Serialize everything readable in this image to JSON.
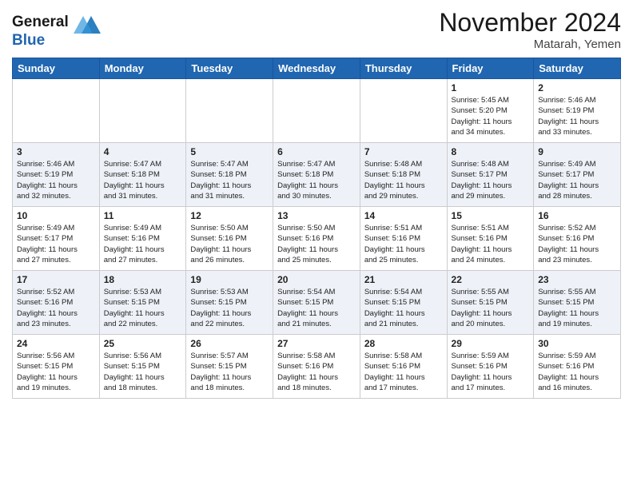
{
  "header": {
    "logo_line1": "General",
    "logo_line2": "Blue",
    "month_title": "November 2024",
    "location": "Matarah, Yemen"
  },
  "weekdays": [
    "Sunday",
    "Monday",
    "Tuesday",
    "Wednesday",
    "Thursday",
    "Friday",
    "Saturday"
  ],
  "weeks": [
    [
      {
        "day": "",
        "info": ""
      },
      {
        "day": "",
        "info": ""
      },
      {
        "day": "",
        "info": ""
      },
      {
        "day": "",
        "info": ""
      },
      {
        "day": "",
        "info": ""
      },
      {
        "day": "1",
        "info": "Sunrise: 5:45 AM\nSunset: 5:20 PM\nDaylight: 11 hours\nand 34 minutes."
      },
      {
        "day": "2",
        "info": "Sunrise: 5:46 AM\nSunset: 5:19 PM\nDaylight: 11 hours\nand 33 minutes."
      }
    ],
    [
      {
        "day": "3",
        "info": "Sunrise: 5:46 AM\nSunset: 5:19 PM\nDaylight: 11 hours\nand 32 minutes."
      },
      {
        "day": "4",
        "info": "Sunrise: 5:47 AM\nSunset: 5:18 PM\nDaylight: 11 hours\nand 31 minutes."
      },
      {
        "day": "5",
        "info": "Sunrise: 5:47 AM\nSunset: 5:18 PM\nDaylight: 11 hours\nand 31 minutes."
      },
      {
        "day": "6",
        "info": "Sunrise: 5:47 AM\nSunset: 5:18 PM\nDaylight: 11 hours\nand 30 minutes."
      },
      {
        "day": "7",
        "info": "Sunrise: 5:48 AM\nSunset: 5:18 PM\nDaylight: 11 hours\nand 29 minutes."
      },
      {
        "day": "8",
        "info": "Sunrise: 5:48 AM\nSunset: 5:17 PM\nDaylight: 11 hours\nand 29 minutes."
      },
      {
        "day": "9",
        "info": "Sunrise: 5:49 AM\nSunset: 5:17 PM\nDaylight: 11 hours\nand 28 minutes."
      }
    ],
    [
      {
        "day": "10",
        "info": "Sunrise: 5:49 AM\nSunset: 5:17 PM\nDaylight: 11 hours\nand 27 minutes."
      },
      {
        "day": "11",
        "info": "Sunrise: 5:49 AM\nSunset: 5:16 PM\nDaylight: 11 hours\nand 27 minutes."
      },
      {
        "day": "12",
        "info": "Sunrise: 5:50 AM\nSunset: 5:16 PM\nDaylight: 11 hours\nand 26 minutes."
      },
      {
        "day": "13",
        "info": "Sunrise: 5:50 AM\nSunset: 5:16 PM\nDaylight: 11 hours\nand 25 minutes."
      },
      {
        "day": "14",
        "info": "Sunrise: 5:51 AM\nSunset: 5:16 PM\nDaylight: 11 hours\nand 25 minutes."
      },
      {
        "day": "15",
        "info": "Sunrise: 5:51 AM\nSunset: 5:16 PM\nDaylight: 11 hours\nand 24 minutes."
      },
      {
        "day": "16",
        "info": "Sunrise: 5:52 AM\nSunset: 5:16 PM\nDaylight: 11 hours\nand 23 minutes."
      }
    ],
    [
      {
        "day": "17",
        "info": "Sunrise: 5:52 AM\nSunset: 5:16 PM\nDaylight: 11 hours\nand 23 minutes."
      },
      {
        "day": "18",
        "info": "Sunrise: 5:53 AM\nSunset: 5:15 PM\nDaylight: 11 hours\nand 22 minutes."
      },
      {
        "day": "19",
        "info": "Sunrise: 5:53 AM\nSunset: 5:15 PM\nDaylight: 11 hours\nand 22 minutes."
      },
      {
        "day": "20",
        "info": "Sunrise: 5:54 AM\nSunset: 5:15 PM\nDaylight: 11 hours\nand 21 minutes."
      },
      {
        "day": "21",
        "info": "Sunrise: 5:54 AM\nSunset: 5:15 PM\nDaylight: 11 hours\nand 21 minutes."
      },
      {
        "day": "22",
        "info": "Sunrise: 5:55 AM\nSunset: 5:15 PM\nDaylight: 11 hours\nand 20 minutes."
      },
      {
        "day": "23",
        "info": "Sunrise: 5:55 AM\nSunset: 5:15 PM\nDaylight: 11 hours\nand 19 minutes."
      }
    ],
    [
      {
        "day": "24",
        "info": "Sunrise: 5:56 AM\nSunset: 5:15 PM\nDaylight: 11 hours\nand 19 minutes."
      },
      {
        "day": "25",
        "info": "Sunrise: 5:56 AM\nSunset: 5:15 PM\nDaylight: 11 hours\nand 18 minutes."
      },
      {
        "day": "26",
        "info": "Sunrise: 5:57 AM\nSunset: 5:15 PM\nDaylight: 11 hours\nand 18 minutes."
      },
      {
        "day": "27",
        "info": "Sunrise: 5:58 AM\nSunset: 5:16 PM\nDaylight: 11 hours\nand 18 minutes."
      },
      {
        "day": "28",
        "info": "Sunrise: 5:58 AM\nSunset: 5:16 PM\nDaylight: 11 hours\nand 17 minutes."
      },
      {
        "day": "29",
        "info": "Sunrise: 5:59 AM\nSunset: 5:16 PM\nDaylight: 11 hours\nand 17 minutes."
      },
      {
        "day": "30",
        "info": "Sunrise: 5:59 AM\nSunset: 5:16 PM\nDaylight: 11 hours\nand 16 minutes."
      }
    ]
  ]
}
